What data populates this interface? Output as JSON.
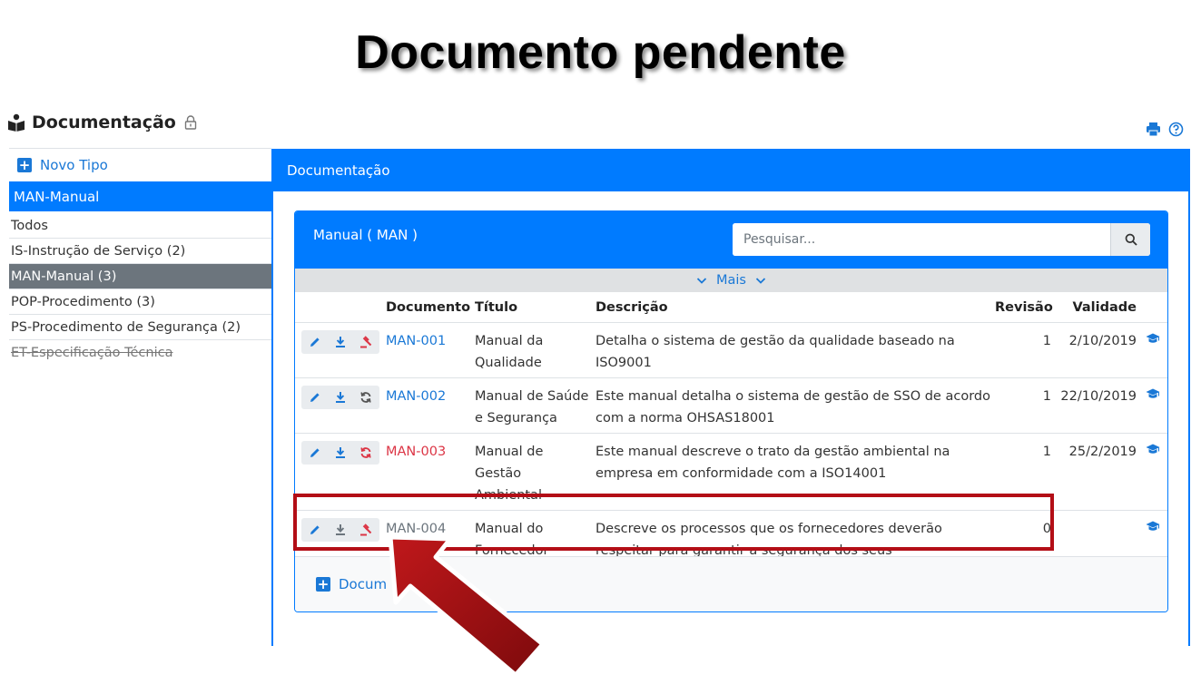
{
  "slide": {
    "title": "Documento pendente"
  },
  "app": {
    "title": "Documentação"
  },
  "icons": {
    "book": "book-reader-icon",
    "lock": "lock-icon",
    "print": "print-icon",
    "help": "help-icon"
  },
  "sidebar": {
    "new_type_label": "Novo Tipo",
    "active_type": "MAN-Manual",
    "types": [
      {
        "label": "Todos",
        "selected": false,
        "disabled": false
      },
      {
        "label": "IS-Instrução de Serviço (2)",
        "selected": false,
        "disabled": false
      },
      {
        "label": "MAN-Manual (3)",
        "selected": true,
        "disabled": false
      },
      {
        "label": "POP-Procedimento (3)",
        "selected": false,
        "disabled": false
      },
      {
        "label": "PS-Procedimento de Segurança (2)",
        "selected": false,
        "disabled": false
      },
      {
        "label": "ET-Especificação Técnica",
        "selected": false,
        "disabled": true
      }
    ]
  },
  "main": {
    "header": "Documentação",
    "card_title": "Manual ( MAN )",
    "search_placeholder": "Pesquisar...",
    "more_label": "Mais",
    "columns": {
      "documento": "Documento",
      "titulo": "Título",
      "descricao": "Descrição",
      "revisao": "Revisão",
      "validade": "Validade"
    },
    "rows": [
      {
        "code": "MAN-001",
        "title": "Manual da Qualidade",
        "description": "Detalha o sistema de gestão da qualidade baseado na ISO9001",
        "revision": "1",
        "validity": "2/10/2019",
        "status": "ok",
        "third_action": "gavel-icon"
      },
      {
        "code": "MAN-002",
        "title": "Manual de Saúde e Segurança",
        "description": "Este manual detalha o sistema de gestão de SSO de acordo com a norma OHSAS18001",
        "revision": "1",
        "validity": "22/10/2019",
        "status": "ok",
        "third_action": "sync-icon"
      },
      {
        "code": "MAN-003",
        "title": "Manual de Gestão Ambiental",
        "description": "Este manual descreve o trato da gestão ambiental na empresa em conformidade com a ISO14001",
        "revision": "1",
        "validity": "25/2/2019",
        "status": "overdue",
        "third_action": "sync-icon"
      },
      {
        "code": "MAN-004",
        "title": "Manual do Fornecedor",
        "description": "Descreve os processos que os fornecedores deverão respeitar para garantir a segurança dos seus trabalhadores.",
        "revision": "0",
        "validity": "",
        "status": "pending",
        "third_action": "gavel-icon"
      }
    ],
    "footer_button": "Docum"
  },
  "colors": {
    "primary": "#007bff",
    "danger": "#dc3545",
    "highlight": "#b30e16",
    "arrow": "#a80d10"
  }
}
